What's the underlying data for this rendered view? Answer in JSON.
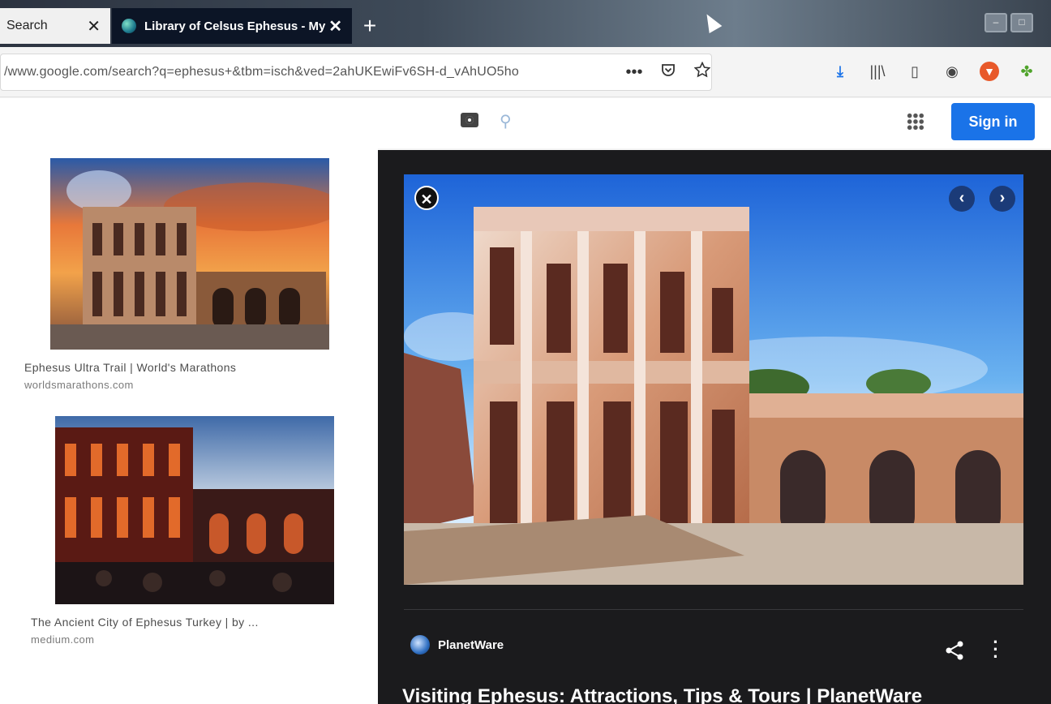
{
  "browser": {
    "tabs": [
      {
        "title": "Search",
        "close": "✕"
      },
      {
        "title": "Library of Celsus Ephesus - My",
        "close": "✕"
      }
    ],
    "new_tab": "+",
    "url": "/www.google.com/search?q=ephesus+&tbm=isch&ved=2ahUKEwiFv6SH-d_vAhUO5ho",
    "url_actions": [
      "•••",
      "pocket-icon",
      "star-icon"
    ],
    "toolbar_icons": [
      "download-icon",
      "library-icon",
      "sidebar-icon",
      "account-icon",
      "ublock-icon",
      "extension-icon"
    ]
  },
  "google_header": {
    "sign_in": "Sign in",
    "icons": [
      "camera-icon",
      "search-icon",
      "apps-icon"
    ]
  },
  "results": [
    {
      "title": "Ephesus Ultra Trail | World's Marathons",
      "domain": "worldsmarathons.com"
    },
    {
      "title": "The Ancient City of Ephesus Turkey | by ...",
      "domain": "medium.com"
    }
  ],
  "preview": {
    "source": "PlanetWare",
    "title": "Visiting Ephesus: Attractions, Tips & Tours | PlanetWare",
    "nav_prev": "‹",
    "nav_next": "›",
    "close": "✕"
  },
  "colors": {
    "accent_blue": "#1a73e8",
    "panel_bg": "#1b1b1d",
    "active_tab_bg": "#0c1526"
  }
}
